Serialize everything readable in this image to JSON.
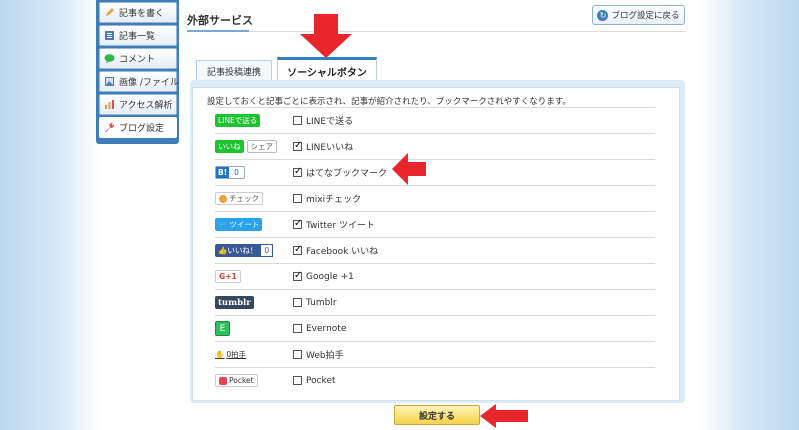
{
  "sidebar": {
    "items": [
      {
        "label": "記事を書く",
        "icon": "pencil-icon",
        "color": "#e8a33c"
      },
      {
        "label": "記事一覧",
        "icon": "list-icon",
        "color": "#4a7cc0"
      },
      {
        "label": "コメント",
        "icon": "comment-icon",
        "color": "#2db84b"
      },
      {
        "label": "画像 /ファイル",
        "icon": "image-icon",
        "color": "#4a7cc0"
      },
      {
        "label": "アクセス解析",
        "icon": "chart-icon",
        "color": "#e8a33c"
      },
      {
        "label": "ブログ設定",
        "icon": "wrench-icon",
        "color": "#d9534f"
      }
    ]
  },
  "header": {
    "title": "外部サービス",
    "back_label": "ブログ設定に戻る"
  },
  "tabs": [
    {
      "label": "記事投稿連携",
      "active": false
    },
    {
      "label": "ソーシャルボタン",
      "active": true
    }
  ],
  "description": "設定しておくと記事ごとに表示され、記事が紹介されたり、ブックマークされやすくなります。",
  "services": [
    {
      "badge": "LINEで送る",
      "label": "LINEで送る",
      "checked": false
    },
    {
      "badge": "いいね",
      "badge2": "シェア",
      "label": "LINEいいね",
      "checked": true
    },
    {
      "badge": "B!",
      "badge2": "0",
      "label": "はてなブックマーク",
      "checked": true
    },
    {
      "badge": "チェック",
      "label": "mixiチェック",
      "checked": false
    },
    {
      "badge": "ツイート",
      "label": "Twitter ツイート",
      "checked": true
    },
    {
      "badge": "いいね！",
      "badge2": "0",
      "label": "Facebook いいね",
      "checked": true
    },
    {
      "badge": "G+1",
      "label": "Google +1",
      "checked": true
    },
    {
      "badge": "tumblr",
      "label": "Tumblr",
      "checked": false
    },
    {
      "badge": "E",
      "label": "Evernote",
      "checked": false
    },
    {
      "badge": "0拍手",
      "label": "Web拍手",
      "checked": false
    },
    {
      "badge": "Pocket",
      "label": "Pocket",
      "checked": false
    }
  ],
  "submit_label": "設定する",
  "colors": {
    "accent": "#2e7fc4",
    "annotation_arrow": "#e8262b",
    "submit": "#f6d24a"
  }
}
